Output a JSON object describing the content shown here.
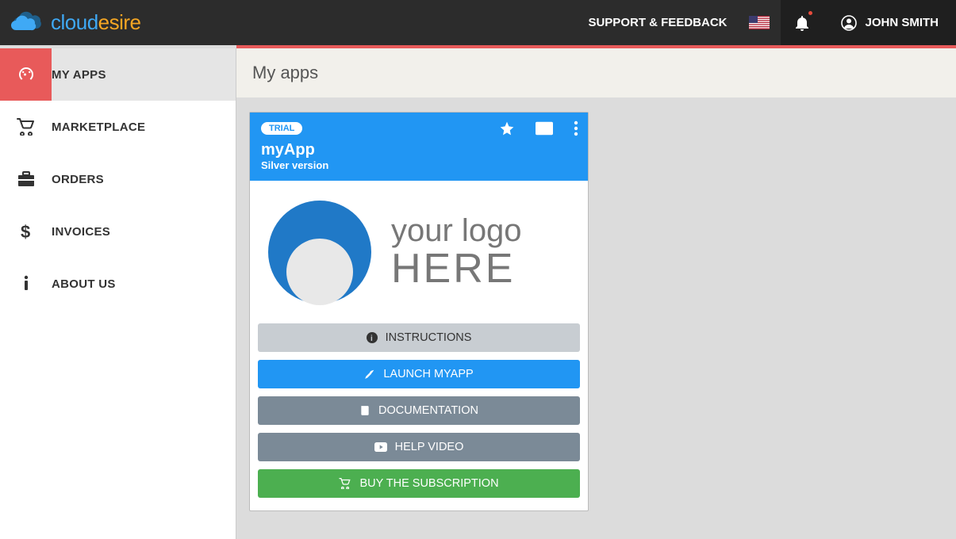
{
  "header": {
    "logo_part1": "cloud",
    "logo_part2": "esire",
    "support_label": "SUPPORT & FEEDBACK",
    "user_name": "JOHN SMITH"
  },
  "sidebar": {
    "items": [
      {
        "label": "MY APPS"
      },
      {
        "label": "MARKETPLACE"
      },
      {
        "label": "ORDERS"
      },
      {
        "label": "INVOICES"
      },
      {
        "label": "ABOUT US"
      }
    ]
  },
  "page": {
    "title": "My apps"
  },
  "card": {
    "badge": "TRIAL",
    "name": "myApp",
    "version": "Silver version",
    "logo_line1": "your logo",
    "logo_line2": "HERE",
    "buttons": {
      "instructions": "INSTRUCTIONS",
      "launch": "LAUNCH MYAPP",
      "documentation": "DOCUMENTATION",
      "help_video": "HELP VIDEO",
      "buy": "BUY THE SUBSCRIPTION"
    }
  }
}
